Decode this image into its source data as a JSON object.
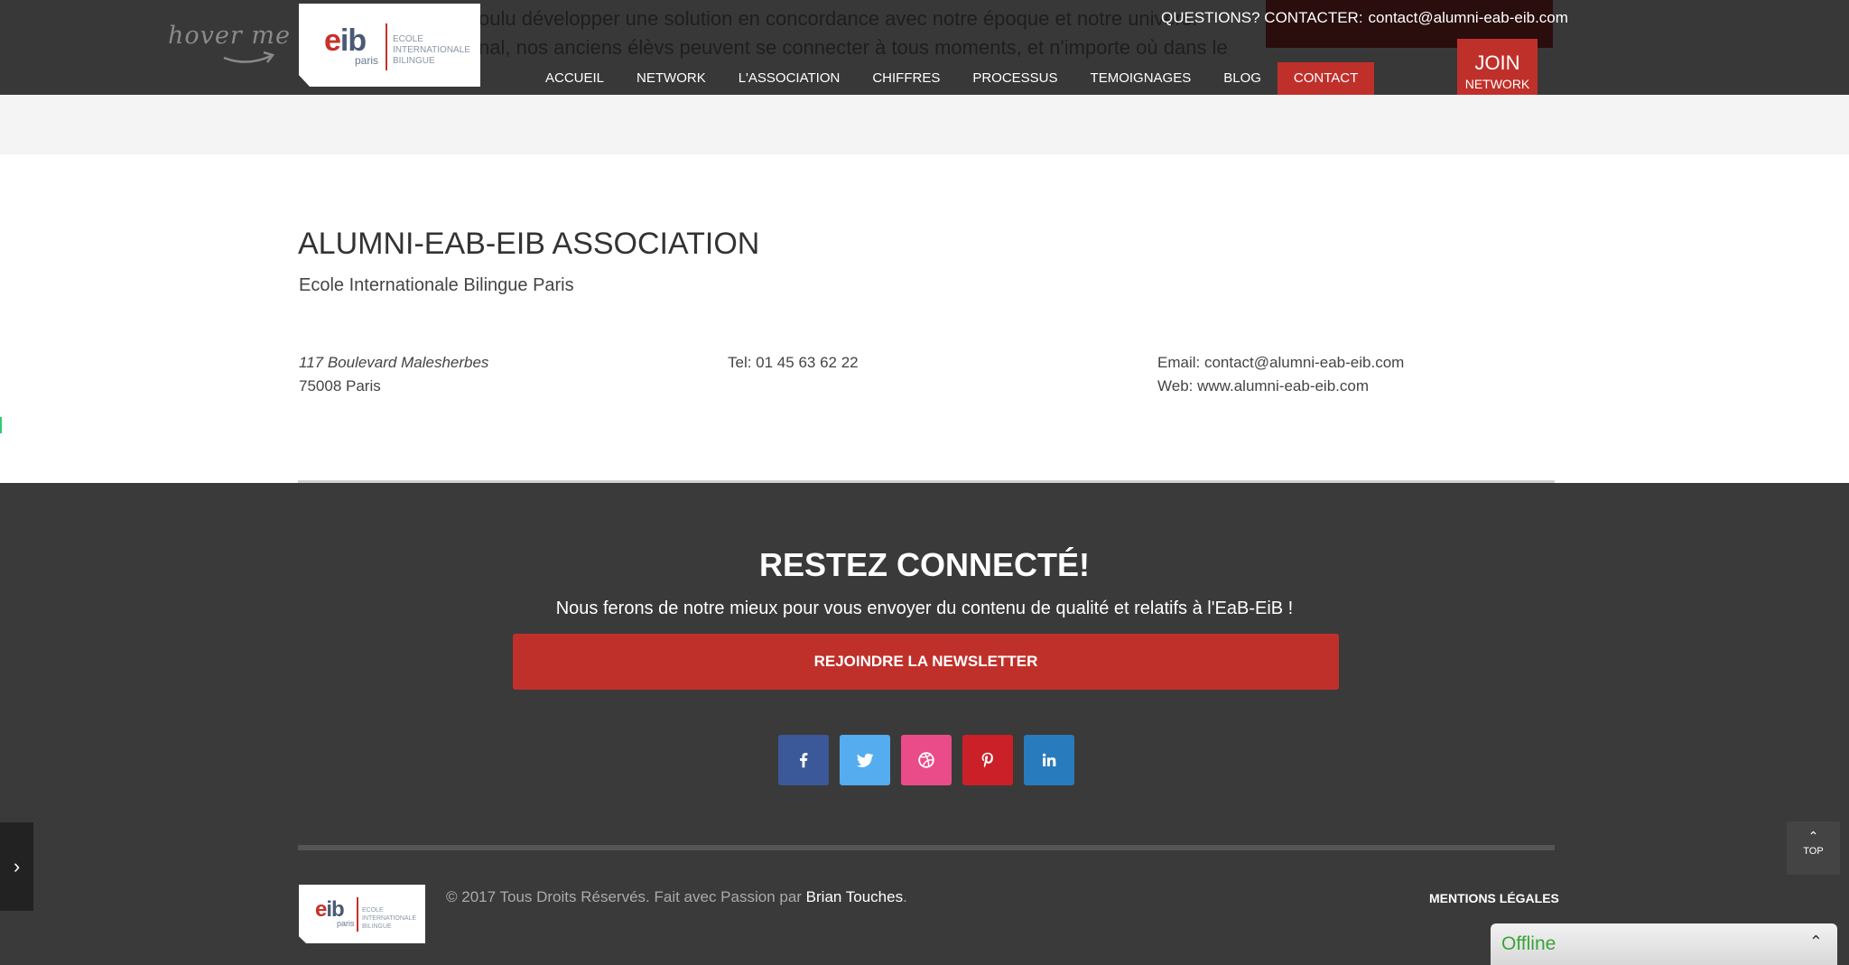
{
  "header": {
    "hover_me": "hover me",
    "bg_text_line1": "oulu développer une solution en concordance avec notre époque et notre univers.",
    "bg_text_line2": "nal, nos anciens élèvs peuvent se connecter à tous moments, et n'importe où dans le",
    "logo": {
      "mark_e": "e",
      "mark_ib": "ib",
      "city": "paris",
      "school_line1": "Ecole",
      "school_line2": "Internationale",
      "school_line3": "Bilingue"
    },
    "questions_label": "QUESTIONS? CONTACTER:",
    "questions_email": "contact@alumni-eab-eib.com",
    "join_big": "JOIN",
    "join_small": "NETWORK",
    "nav": [
      "ACCUEIL",
      "NETWORK",
      "L'ASSOCIATION",
      "CHIFFRES",
      "PROCESSUS",
      "TEMOIGNAGES",
      "BLOG",
      "CONTACT"
    ],
    "nav_active": "CONTACT"
  },
  "info": {
    "title": "ALUMNI-EAB-EIB ASSOCIATION",
    "subtitle": "Ecole Internationale Bilingue Paris",
    "address_street": "117 Boulevard Malesherbes",
    "address_city": "75008 Paris",
    "tel": "Tel: 01 45 63 62 22",
    "email": "Email: contact@alumni-eab-eib.com",
    "web": "Web: www.alumni-eab-eib.com"
  },
  "footer": {
    "title": "RESTEZ CONNECTÉ!",
    "subtitle": "Nous ferons de notre mieux pour vous envoyer du contenu de qualité et relatifs à l'EaB-EiB !",
    "newsletter_button": "REJOINDRE LA NEWSLETTER",
    "socials": [
      {
        "name": "facebook-icon",
        "color": "#3b5998"
      },
      {
        "name": "twitter-icon",
        "color": "#55acee"
      },
      {
        "name": "dribbble-icon",
        "color": "#ea4c89"
      },
      {
        "name": "pinterest-icon",
        "color": "#cb2027"
      },
      {
        "name": "linkedin-icon",
        "color": "#287bbc"
      }
    ],
    "copyright_prefix": "© 2017 Tous Droits Réservés. Fait avec Passion par ",
    "copyright_author": "Brian Touches",
    "copyright_suffix": ".",
    "legal": "MENTIONS LÉGALES"
  },
  "widgets": {
    "side_toggle": "›",
    "top_arrow": "⌃",
    "top_label": "TOP",
    "chat_status": "Offline",
    "chat_chevron": "⌃"
  },
  "colors": {
    "accent": "#c0302b",
    "header_bg": "#383838",
    "footer_bg": "#3a3a3a",
    "chat_status": "#3aa33a"
  }
}
